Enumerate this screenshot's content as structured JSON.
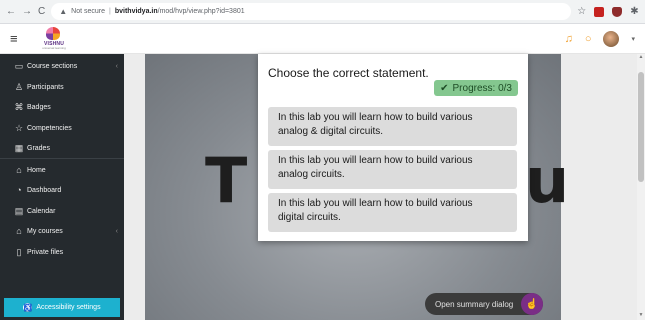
{
  "browser": {
    "back": "←",
    "forward": "→",
    "reload": "C",
    "not_secure": "Not secure",
    "separator": "|",
    "url_host": "bvithvidya.in",
    "url_path": "/mod/hvp/view.php?id=3801"
  },
  "header": {
    "logo_text": "VISHNU",
    "logo_sub": "universal learning"
  },
  "sidebar": {
    "items": [
      {
        "label": "Course sections",
        "icon": "folder-icon"
      },
      {
        "label": "Participants",
        "icon": "users-icon"
      },
      {
        "label": "Badges",
        "icon": "badge-icon"
      },
      {
        "label": "Competencies",
        "icon": "competencies-icon"
      },
      {
        "label": "Grades",
        "icon": "grades-icon"
      },
      {
        "label": "Home",
        "icon": "home-icon"
      },
      {
        "label": "Dashboard",
        "icon": "dashboard-icon"
      },
      {
        "label": "Calendar",
        "icon": "calendar-icon"
      },
      {
        "label": "My courses",
        "icon": "graduation-cap-icon"
      },
      {
        "label": "Private files",
        "icon": "file-icon"
      }
    ],
    "accessibility_label": "Accessibility settings"
  },
  "stage": {
    "big_left": "T",
    "big_right": "u"
  },
  "card": {
    "question": "Choose the correct statement.",
    "progress_label": "Progress: 0/3",
    "progress_value": 0,
    "progress_total": 3,
    "options": [
      {
        "line1": "In this lab you will learn how to build various",
        "line2": "analog & digital circuits."
      },
      {
        "line1": "In this lab you will learn how to build various",
        "line2": "analog circuits."
      },
      {
        "line1": "In this lab you will learn how to build various",
        "line2": "digital circuits."
      }
    ]
  },
  "summary_button": "Open summary dialog",
  "colors": {
    "sidebar_bg": "#252a2e",
    "accessibility_bg": "#1db1cf",
    "progress_bg": "#84c78f",
    "option_bg": "#dcdcdc",
    "summary_accent": "#7a2e86"
  }
}
